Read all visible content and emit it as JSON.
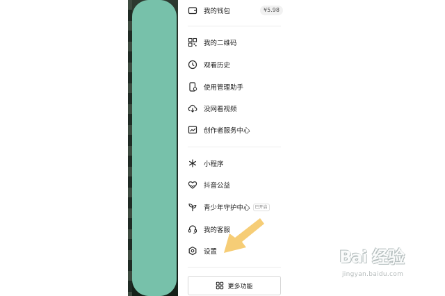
{
  "menu": {
    "wallet": {
      "label": "我的钱包",
      "balance": "¥5.98"
    },
    "items_group1": [
      {
        "label": "我的二维码",
        "icon": "qr-code-icon"
      },
      {
        "label": "观看历史",
        "icon": "clock-icon"
      },
      {
        "label": "使用管理助手",
        "icon": "phone-manager-icon"
      },
      {
        "label": "没网看视频",
        "icon": "cloud-download-icon"
      },
      {
        "label": "创作者服务中心",
        "icon": "chart-icon"
      }
    ],
    "items_group2": [
      {
        "label": "小程序",
        "icon": "asterisk-icon"
      },
      {
        "label": "抖音公益",
        "icon": "heart-hands-icon"
      },
      {
        "label": "青少年守护中心",
        "icon": "sprout-icon",
        "tag": "已开启"
      },
      {
        "label": "我的客服",
        "icon": "headset-icon"
      },
      {
        "label": "设置",
        "icon": "gear-icon"
      }
    ],
    "more_button": {
      "label": "更多功能",
      "icon": "grid-icon"
    }
  },
  "watermark": {
    "logo_text": "Bai 经验",
    "url": "jingyan.baidu.com"
  },
  "colors": {
    "redaction": "#77c1aa",
    "arrow": "#f5c96a",
    "divider": "#ececec"
  }
}
